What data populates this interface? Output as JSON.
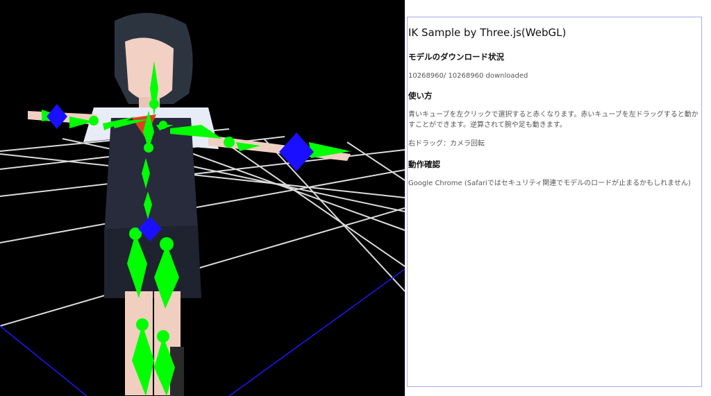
{
  "viewport": {
    "grid_color": "#e0e0e0",
    "boundary_color": "#1a1aff",
    "effector_color": "#1a10ff",
    "bone_color": "#00ff00",
    "background": "#000000"
  },
  "panel": {
    "title": "IK Sample by Three.js(WebGL)",
    "download_heading": "モデルのダウンロード状況",
    "download_status": "10268960/ 10268960 downloaded",
    "usage_heading": "使い方",
    "usage_text": "青いキューブを左クリックで選択すると赤くなります。赤いキューブを左ドラッグすると動かすことができます。逆算されて腕や足も動きます。",
    "camera_text": "右ドラッグ：カメラ回転",
    "compat_heading": "動作確認",
    "compat_text": "Google Chrome (Safariではセキュリティ関連でモデルのロードが止まるかもしれません)",
    "border_color": "#a8a8f0"
  }
}
